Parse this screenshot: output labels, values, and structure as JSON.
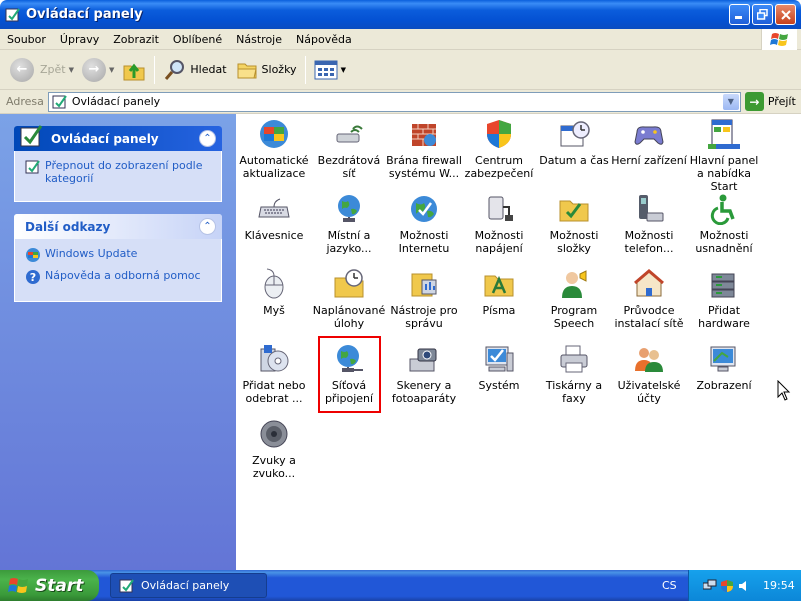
{
  "window": {
    "title": "Ovládací panely"
  },
  "menu": [
    "Soubor",
    "Úpravy",
    "Zobrazit",
    "Oblíbené",
    "Nástroje",
    "Nápověda"
  ],
  "toolbar": {
    "back": "Zpět",
    "search": "Hledat",
    "folders": "Složky"
  },
  "address": {
    "label": "Adresa",
    "value": "Ovládací panely",
    "go": "Přejít"
  },
  "sidebar": {
    "control_panel": {
      "title": "Ovládací panely",
      "links": [
        "Přepnout do zobrazení podle kategorií"
      ]
    },
    "other_links": {
      "title": "Další odkazy",
      "links": [
        "Windows Update",
        "Nápověda a odborná pomoc"
      ]
    }
  },
  "items": [
    {
      "label": "Automatické aktualizace",
      "icon": "windows-update-icon"
    },
    {
      "label": "Bezdrátová síť",
      "icon": "wireless-network-icon"
    },
    {
      "label": "Brána firewall systému W...",
      "icon": "firewall-icon"
    },
    {
      "label": "Centrum zabezpečení",
      "icon": "security-center-icon"
    },
    {
      "label": "Datum a čas",
      "icon": "date-time-icon"
    },
    {
      "label": "Herní zařízení",
      "icon": "game-controller-icon"
    },
    {
      "label": "Hlavní panel a nabídka Start",
      "icon": "taskbar-start-icon"
    },
    {
      "label": "Klávesnice",
      "icon": "keyboard-icon"
    },
    {
      "label": "Místní a jazyko...",
      "icon": "regional-language-icon"
    },
    {
      "label": "Možnosti Internetu",
      "icon": "internet-options-icon"
    },
    {
      "label": "Možnosti napájení",
      "icon": "power-options-icon"
    },
    {
      "label": "Možnosti složky",
      "icon": "folder-options-icon"
    },
    {
      "label": "Možnosti telefon...",
      "icon": "phone-modem-icon"
    },
    {
      "label": "Možnosti usnadnění",
      "icon": "accessibility-icon"
    },
    {
      "label": "Myš",
      "icon": "mouse-icon"
    },
    {
      "label": "Naplánované úlohy",
      "icon": "scheduled-tasks-icon"
    },
    {
      "label": "Nástroje pro správu",
      "icon": "admin-tools-icon"
    },
    {
      "label": "Písma",
      "icon": "fonts-icon"
    },
    {
      "label": "Program Speech",
      "icon": "speech-icon"
    },
    {
      "label": "Průvodce instalací sítě",
      "icon": "network-setup-wizard-icon"
    },
    {
      "label": "Přidat hardware",
      "icon": "add-hardware-icon"
    },
    {
      "label": "Přidat nebo odebrat ...",
      "icon": "add-remove-programs-icon"
    },
    {
      "label": "Síťová připojení",
      "icon": "network-connections-icon"
    },
    {
      "label": "Skenery a fotoaparáty",
      "icon": "scanners-cameras-icon"
    },
    {
      "label": "Systém",
      "icon": "system-icon"
    },
    {
      "label": "Tiskárny a faxy",
      "icon": "printers-faxes-icon"
    },
    {
      "label": "Uživatelské účty",
      "icon": "user-accounts-icon"
    },
    {
      "label": "Zobrazení",
      "icon": "display-icon"
    },
    {
      "label": "Zvuky a zvuko...",
      "icon": "sounds-audio-icon"
    }
  ],
  "selected_item": "Síťová připojení",
  "taskbar": {
    "start": "Start",
    "task": "Ovládací panely",
    "lang": "CS",
    "clock": "19:54"
  }
}
